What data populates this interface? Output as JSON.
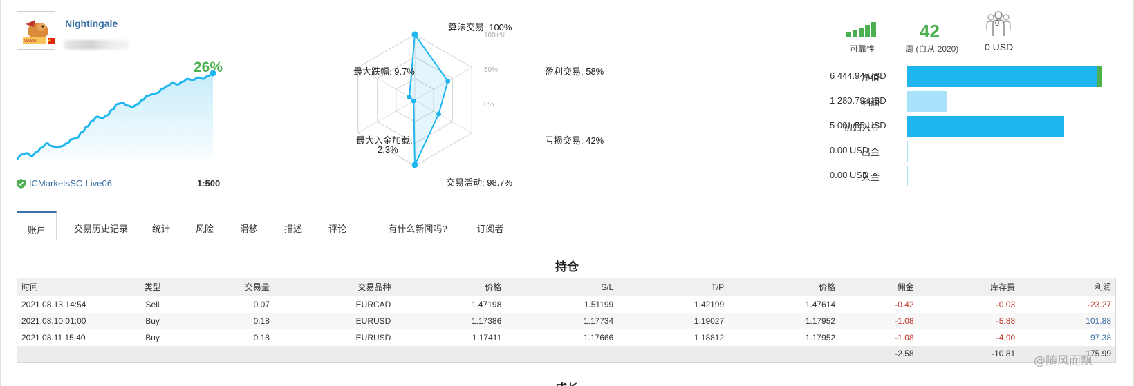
{
  "profile": {
    "name": "Nightingale",
    "country_flag": "china-flag",
    "broker": "ICMarketsSC-Live06",
    "leverage": "1:500"
  },
  "growth": {
    "percent": "26%",
    "curve_values": [
      1,
      4,
      5,
      3,
      6,
      9,
      12,
      10,
      9,
      10,
      12,
      15,
      16,
      20,
      24,
      28,
      31,
      30,
      32,
      36,
      40,
      41,
      39,
      38,
      40,
      43,
      46,
      47,
      48,
      51,
      53,
      55,
      54,
      56,
      58,
      57,
      59,
      58,
      60,
      62
    ]
  },
  "radar": {
    "labels": {
      "algo": "算法交易: 100%",
      "profit": "盈利交易: 58%",
      "loss": "亏损交易: 42%",
      "activity": "交易活动: 98.7%",
      "load": "最大入金加载:",
      "load_value": "2.3%",
      "drawdown": "最大跌幅: 9.7%"
    },
    "ticks": {
      "t100": "100+%",
      "t50": "50%",
      "t0": "0%"
    },
    "values": {
      "algo": 100,
      "profit": 58,
      "loss": 42,
      "activity": 98.7,
      "load": 2.3,
      "drawdown": 9.7
    }
  },
  "stats": {
    "reliability_label": "可靠性",
    "reliability_level": 5,
    "weeks": "42",
    "weeks_label": "周 (自从 2020)",
    "subscribers_count": "0",
    "subscribers_usd": "0 USD"
  },
  "balance": [
    {
      "label": "净值",
      "value": "6 444.94 USD",
      "fraction": 0.97,
      "color": "#1fb5ee",
      "accent": "#4caf50"
    },
    {
      "label": "利润",
      "value": "1 280.79 USD",
      "fraction": 0.2,
      "color": "#a8e2fa"
    },
    {
      "label": "初始入金",
      "value": "5 001.55 USD",
      "fraction": 0.78,
      "color": "#1fb5ee"
    },
    {
      "label": "出金",
      "value": "0.00 USD",
      "fraction": 0.0,
      "color": "#a8e2fa"
    },
    {
      "label": "入金",
      "value": "0.00 USD",
      "fraction": 0.0,
      "color": "#a8e2fa"
    }
  ],
  "tabs": [
    "账户",
    "交易历史记录",
    "统计",
    "风险",
    "滑移",
    "描述",
    "评论",
    "有什么新闻吗?",
    "订阅者"
  ],
  "positions": {
    "title": "持仓",
    "headers": [
      "时间",
      "类型",
      "交易量",
      "交易品种",
      "价格",
      "S/L",
      "T/P",
      "价格",
      "佣金",
      "库存费",
      "利润"
    ],
    "rows": [
      [
        "2021.08.13 14:54",
        "Sell",
        "0.07",
        "EURCAD",
        "1.47198",
        "1.51199",
        "1.42199",
        "1.47614",
        "-0.42",
        "-0.03",
        "-23.27"
      ],
      [
        "2021.08.10 01:00",
        "Buy",
        "0.18",
        "EURUSD",
        "1.17386",
        "1.17734",
        "1.19027",
        "1.17952",
        "-1.08",
        "-5.88",
        "101.88"
      ],
      [
        "2021.08.11 15:40",
        "Buy",
        "0.18",
        "EURUSD",
        "1.17411",
        "1.17666",
        "1.18812",
        "1.17952",
        "-1.08",
        "-4.90",
        "97.38"
      ]
    ],
    "totals": {
      "commission": "-2.58",
      "swap": "-10.81",
      "profit": "175.99"
    }
  },
  "next_section_title": "成长",
  "watermark": "@随风而飘",
  "colors": {
    "accent_blue": "#1fb5ee",
    "green": "#4caf50",
    "link": "#3a6ea5",
    "negative": "#c0392b"
  }
}
